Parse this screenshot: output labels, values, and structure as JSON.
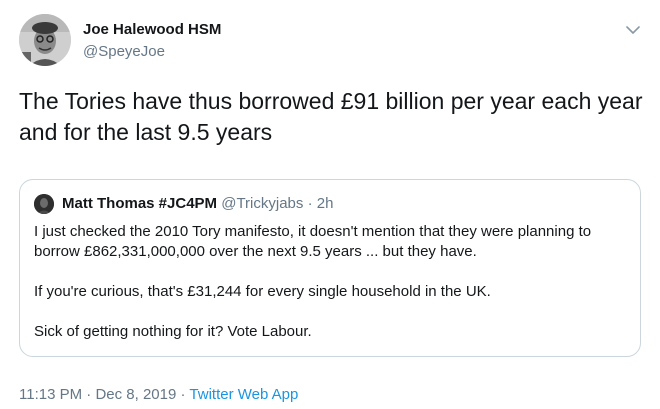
{
  "author": {
    "name": "Joe Halewood HSM",
    "handle": "@SpeyeJoe"
  },
  "tweet": {
    "text": "The Tories have thus borrowed £91 billion per year each year and for the last 9.5 years"
  },
  "quoted_tweet": {
    "name": "Matt Thomas #JC4PM",
    "handle": "@Trickyjabs",
    "separator": "·",
    "time": "2h",
    "paragraphs": [
      "I just checked the 2010 Tory manifesto, it doesn't mention that they were planning to borrow £862,331,000,000 over the next 9.5 years ... but they have.",
      "If you're curious, that's £31,244 for every single household in the UK.",
      "Sick of getting nothing for it? Vote Labour."
    ]
  },
  "footer": {
    "time": "11:13 PM",
    "separator": "·",
    "date": "Dec 8, 2019",
    "source": "Twitter Web App"
  },
  "icons": {
    "caret": "chevron-down-icon"
  },
  "colors": {
    "text": "#14171a",
    "secondary": "#657786",
    "link": "#1b95e0",
    "border": "#ccd6dd"
  }
}
